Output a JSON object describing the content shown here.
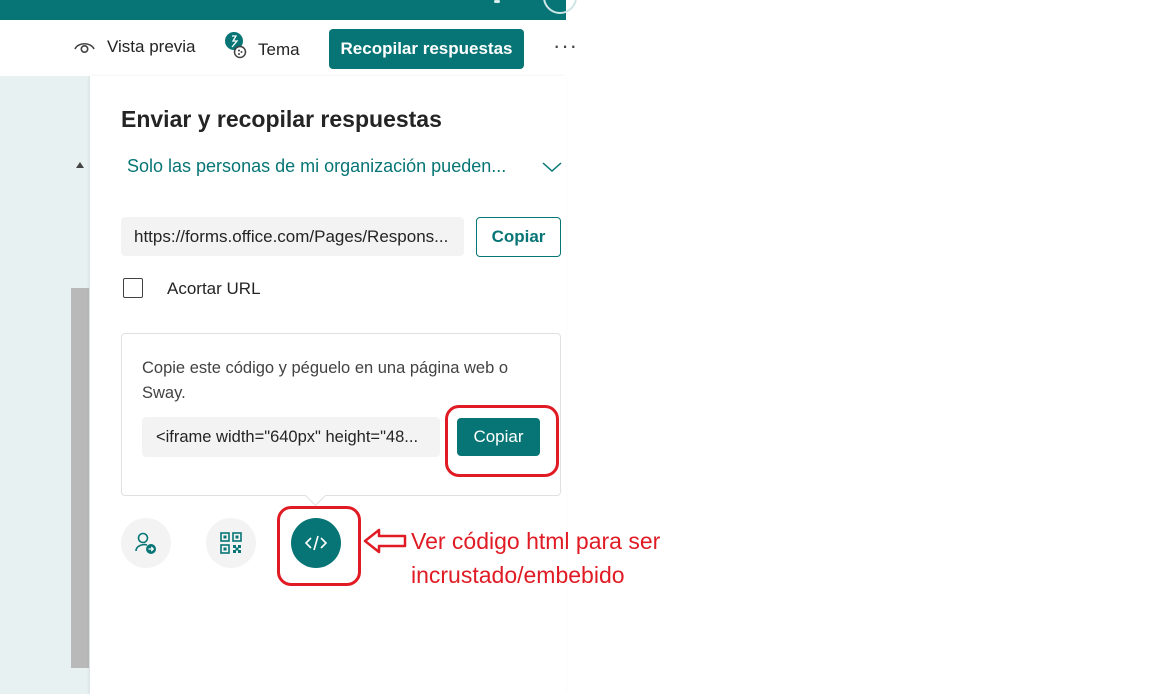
{
  "toolbar": {
    "preview_label": "Vista previa",
    "theme_label": "Tema",
    "collect_label": "Recopilar respuestas",
    "more_label": "···"
  },
  "panel": {
    "title": "Enviar y recopilar respuestas",
    "permission_label": "Solo las personas de mi organización pueden...",
    "url_value": "https://forms.office.com/Pages/Respons...",
    "copy_url_label": "Copiar",
    "shorten_label": "Acortar URL",
    "shorten_checked": false,
    "embed_instruction": "Copie este código y péguelo en una página web o Sway.",
    "embed_code": "<iframe width=\"640px\" height=\"48...",
    "copy_code_label": "Copiar"
  },
  "share_options": [
    "share-people-icon",
    "qr-code-icon",
    "embed-code-icon"
  ],
  "annotation": {
    "line1": "Ver código html para ser",
    "line2": "incrustado/embebido"
  },
  "colors": {
    "accent": "#077575",
    "annotation_red": "#e01b24",
    "sidebar_bg": "#e8f1f2"
  }
}
